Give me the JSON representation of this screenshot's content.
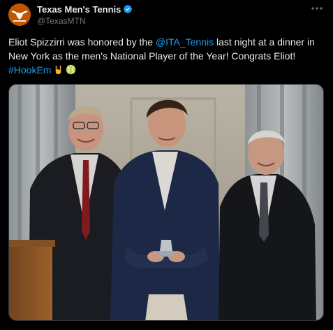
{
  "account": {
    "display_name": "Texas Men's Tennis",
    "handle": "@TexasMTN",
    "avatar_icon": "longhorn-logo-icon",
    "verified_icon": "verified-badge-icon",
    "brand_color": "#bf5700",
    "verified_color": "#1d9bf0"
  },
  "menu": {
    "icon": "more-horizontal-icon"
  },
  "tweet": {
    "text_part1": "Eliot Spizzirri was honored by the ",
    "mention": "@ITA_Tennis",
    "text_part2": " last night at a dinner in New York as the men's National Player of the Year! Congrats Eliot!",
    "hashtag": "#HookEm",
    "emojis": [
      "hook-em-hand-icon",
      "tennis-ball-icon"
    ],
    "link_color": "#1d9bf0"
  },
  "media": {
    "kind": "photo"
  }
}
